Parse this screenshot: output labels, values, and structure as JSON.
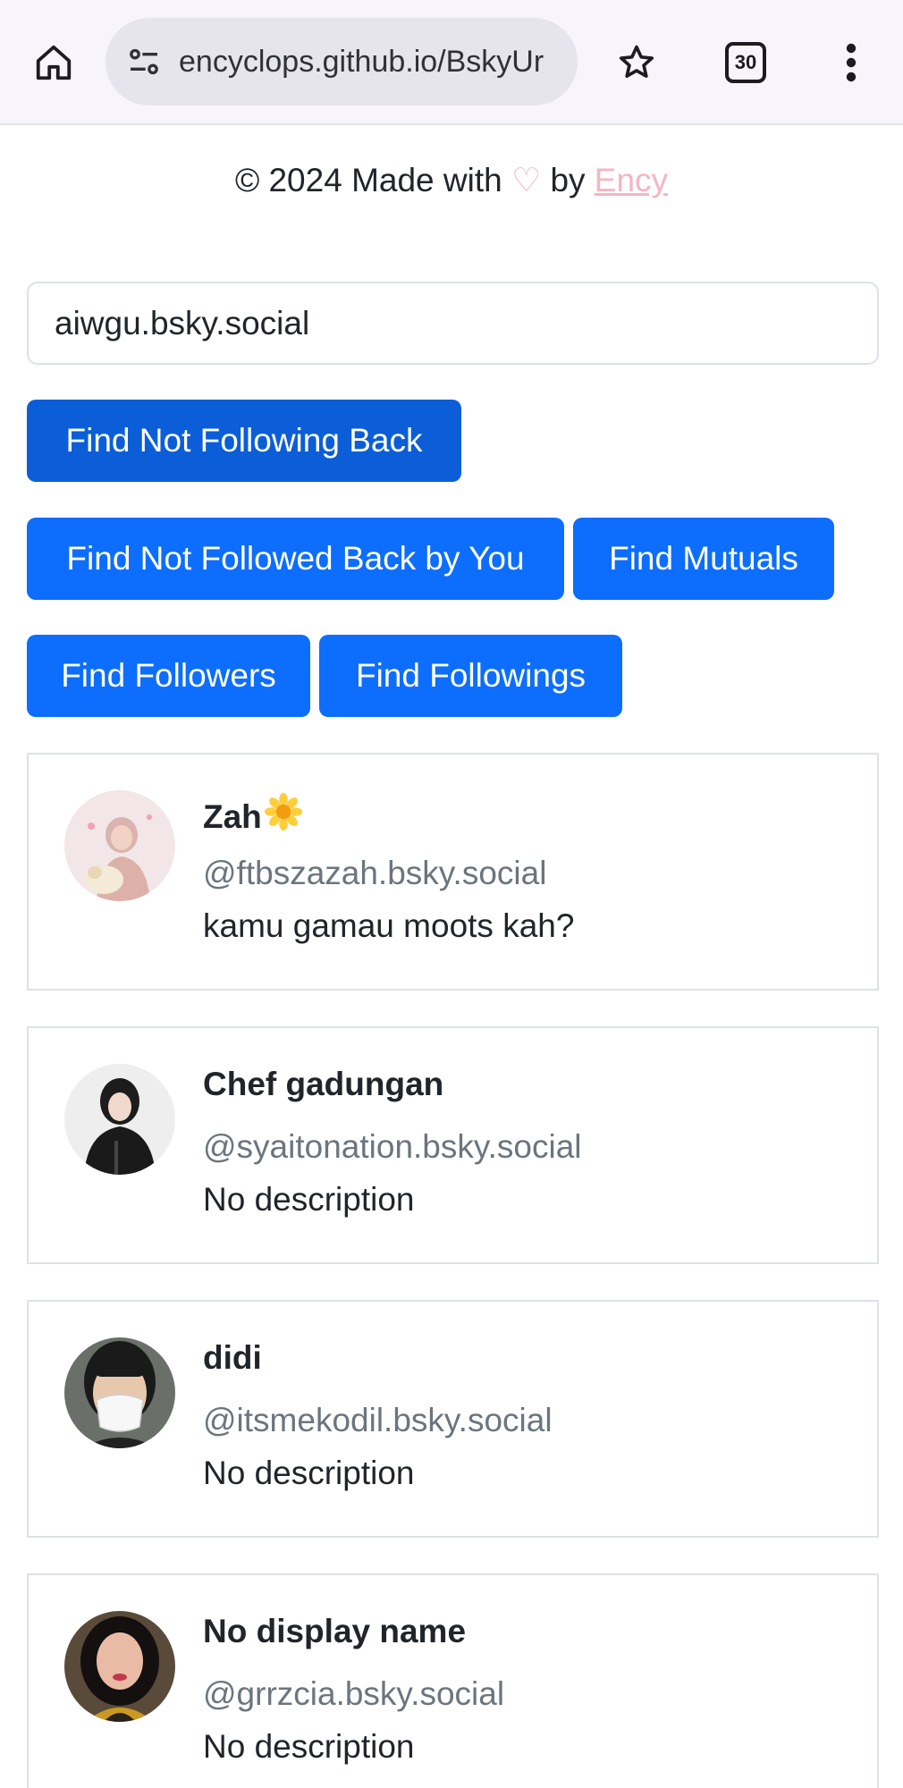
{
  "browser": {
    "url": "encyclops.github.io/BskyUr",
    "tab_count": "30"
  },
  "credit": {
    "prefix": "© 2024 Made with",
    "heart": "♡",
    "by": "by",
    "author": "Ency"
  },
  "search": {
    "value": "aiwgu.bsky.social"
  },
  "buttons": {
    "not_following_back": "Find Not Following Back",
    "not_followed_back_by_you": "Find Not Followed Back by You",
    "mutuals": "Find Mutuals",
    "followers": "Find Followers",
    "followings": "Find Followings"
  },
  "results": [
    {
      "name": "Zah",
      "handle": "@ftbszazah.bsky.social",
      "description": "kamu gamau moots kah?",
      "name_icon": "sunflower-emoji"
    },
    {
      "name": "Chef gadungan",
      "handle": "@syaitonation.bsky.social",
      "description": "No description"
    },
    {
      "name": "didi",
      "handle": "@itsmekodil.bsky.social",
      "description": "No description"
    },
    {
      "name": "No display name",
      "handle": "@grrzcia.bsky.social",
      "description": "No description"
    }
  ],
  "colors": {
    "primary": "#0d6efd",
    "primary_active": "#0b5ed7",
    "accent_pink": "#f4b6c2",
    "muted_text": "#6c757d"
  }
}
